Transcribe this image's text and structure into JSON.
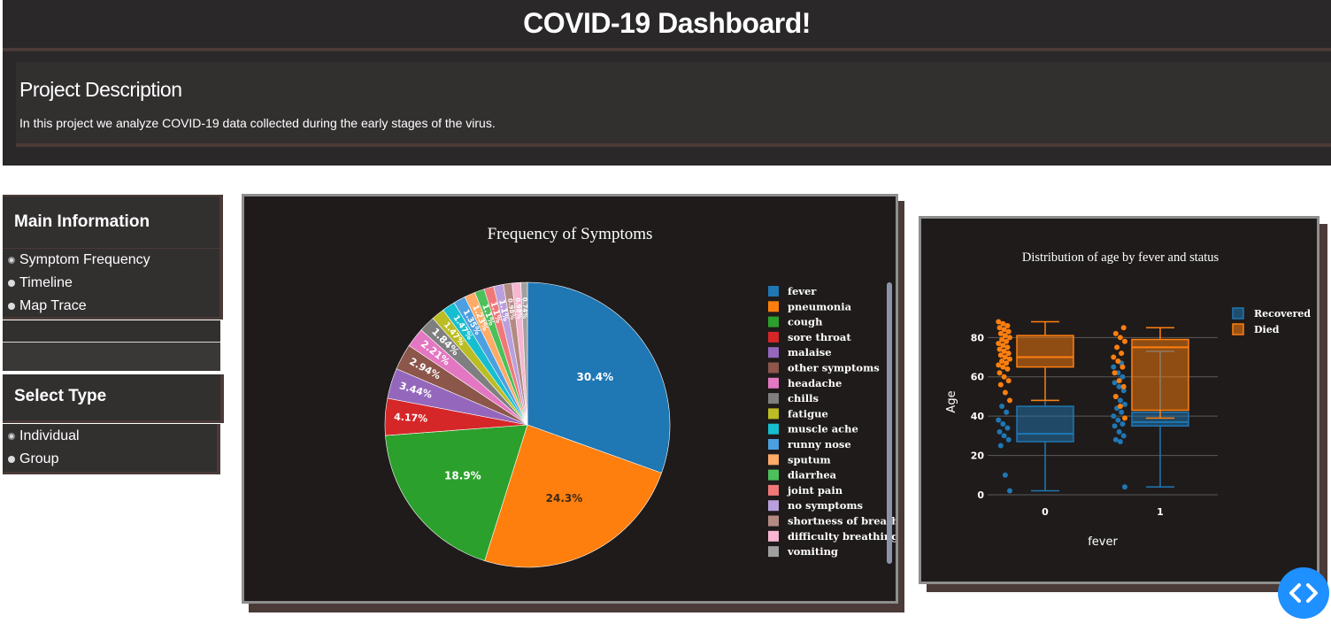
{
  "header": {
    "title": "COVID-19 Dashboard!",
    "description_title": "Project Description",
    "description_text": "In this project we analyze COVID-19 data collected during the early stages of the virus."
  },
  "sidebar": {
    "main_info": {
      "heading": "Main Information",
      "options": [
        "Symptom Frequency",
        "Timeline",
        "Map Trace"
      ],
      "selected": "Symptom Frequency"
    },
    "select_type": {
      "heading": "Select Type",
      "options": [
        "Individual",
        "Group"
      ],
      "selected": "Individual"
    }
  },
  "colors": {
    "header_bg": "#2a2828",
    "panel_bg": "#1f1b1b",
    "accent_blue": "#1f77b4",
    "accent_orange": "#ff7f0e",
    "nav_button": "#1e90ff"
  },
  "nav_icon": "code-icon",
  "chart_data": [
    {
      "type": "pie",
      "title": "Frequency of Symptoms",
      "legend_position": "right",
      "slices": [
        {
          "label": "fever",
          "pct": 30.4,
          "text": "30.4%",
          "color": "#1f77b4"
        },
        {
          "label": "pneumonia",
          "pct": 24.3,
          "text": "24.3%",
          "color": "#ff7f0e"
        },
        {
          "label": "cough",
          "pct": 18.9,
          "text": "18.9%",
          "color": "#2ca02c"
        },
        {
          "label": "sore throat",
          "pct": 4.17,
          "text": "4.17%",
          "color": "#d62728"
        },
        {
          "label": "malaise",
          "pct": 3.44,
          "text": "3.44%",
          "color": "#9467bd"
        },
        {
          "label": "other symptoms",
          "pct": 2.94,
          "text": "2.94%",
          "color": "#8c564b"
        },
        {
          "label": "headache",
          "pct": 2.21,
          "text": "2.21%",
          "color": "#e377c2"
        },
        {
          "label": "chills",
          "pct": 1.84,
          "text": "1.84%",
          "color": "#7f7f7f"
        },
        {
          "label": "fatigue",
          "pct": 1.47,
          "text": "1.47%",
          "color": "#bcbd22"
        },
        {
          "label": "muscle ache",
          "pct": 1.47,
          "text": "1.47%",
          "color": "#17becf"
        },
        {
          "label": "runny nose",
          "pct": 1.35,
          "text": "1.35%",
          "color": "#4c9fe0"
        },
        {
          "label": "sputum",
          "pct": 1.23,
          "text": "1.23%",
          "color": "#ffaa66"
        },
        {
          "label": "diarrhea",
          "pct": 1.1,
          "text": "1.1%",
          "color": "#4cc05a"
        },
        {
          "label": "joint pain",
          "pct": 1.1,
          "text": "1.1%",
          "color": "#f07878"
        },
        {
          "label": "no symptoms",
          "pct": 1.1,
          "text": "1.1%",
          "color": "#b9a0dd"
        },
        {
          "label": "shortness of breath",
          "pct": 0.98,
          "text": "0.98%",
          "color": "#b38a82"
        },
        {
          "label": "difficulty breathing",
          "pct": 0.98,
          "text": "0.98%",
          "color": "#f7b6d2"
        },
        {
          "label": "vomiting",
          "pct": 0.74,
          "text": "0.74%",
          "color": "#a0a0a0"
        }
      ]
    },
    {
      "type": "box",
      "title": "Distribution of age by fever and status",
      "xlabel": "fever",
      "ylabel": "Age",
      "categories": [
        "0",
        "1"
      ],
      "ylim": [
        0,
        95
      ],
      "yticks": [
        0,
        20,
        40,
        60,
        80
      ],
      "legend_position": "top-right",
      "series": [
        {
          "name": "Recovered",
          "color": "#1f77b4",
          "boxes": [
            {
              "category": "0",
              "min": 2,
              "q1": 27,
              "median": 31,
              "q3": 45,
              "max": 48,
              "points": [
                2,
                10,
                25,
                28,
                30,
                32,
                34,
                36,
                38,
                42,
                45
              ]
            },
            {
              "category": "1",
              "min": 4,
              "q1": 35,
              "median": 37,
              "q3": 42,
              "max": 73,
              "points": [
                4,
                27,
                28,
                30,
                32,
                35,
                36,
                38,
                40,
                42,
                44,
                46,
                48,
                50,
                53,
                55,
                57,
                60,
                62,
                65,
                67
              ]
            }
          ]
        },
        {
          "name": "Died",
          "color": "#ff7f0e",
          "boxes": [
            {
              "category": "0",
              "min": 48,
              "q1": 65,
              "median": 70,
              "q3": 81,
              "max": 88,
              "points": [
                48,
                52,
                56,
                58,
                60,
                62,
                64,
                65,
                66,
                67,
                68,
                69,
                70,
                71,
                72,
                73,
                74,
                75,
                76,
                77,
                78,
                79,
                80,
                81,
                82,
                83,
                84,
                85,
                86,
                87,
                88
              ]
            },
            {
              "category": "1",
              "min": 39,
              "q1": 43,
              "median": 75,
              "q3": 79,
              "max": 85,
              "points": [
                39,
                45,
                50,
                55,
                58,
                62,
                65,
                68,
                70,
                72,
                75,
                78,
                80,
                82,
                85
              ]
            }
          ]
        }
      ]
    }
  ]
}
